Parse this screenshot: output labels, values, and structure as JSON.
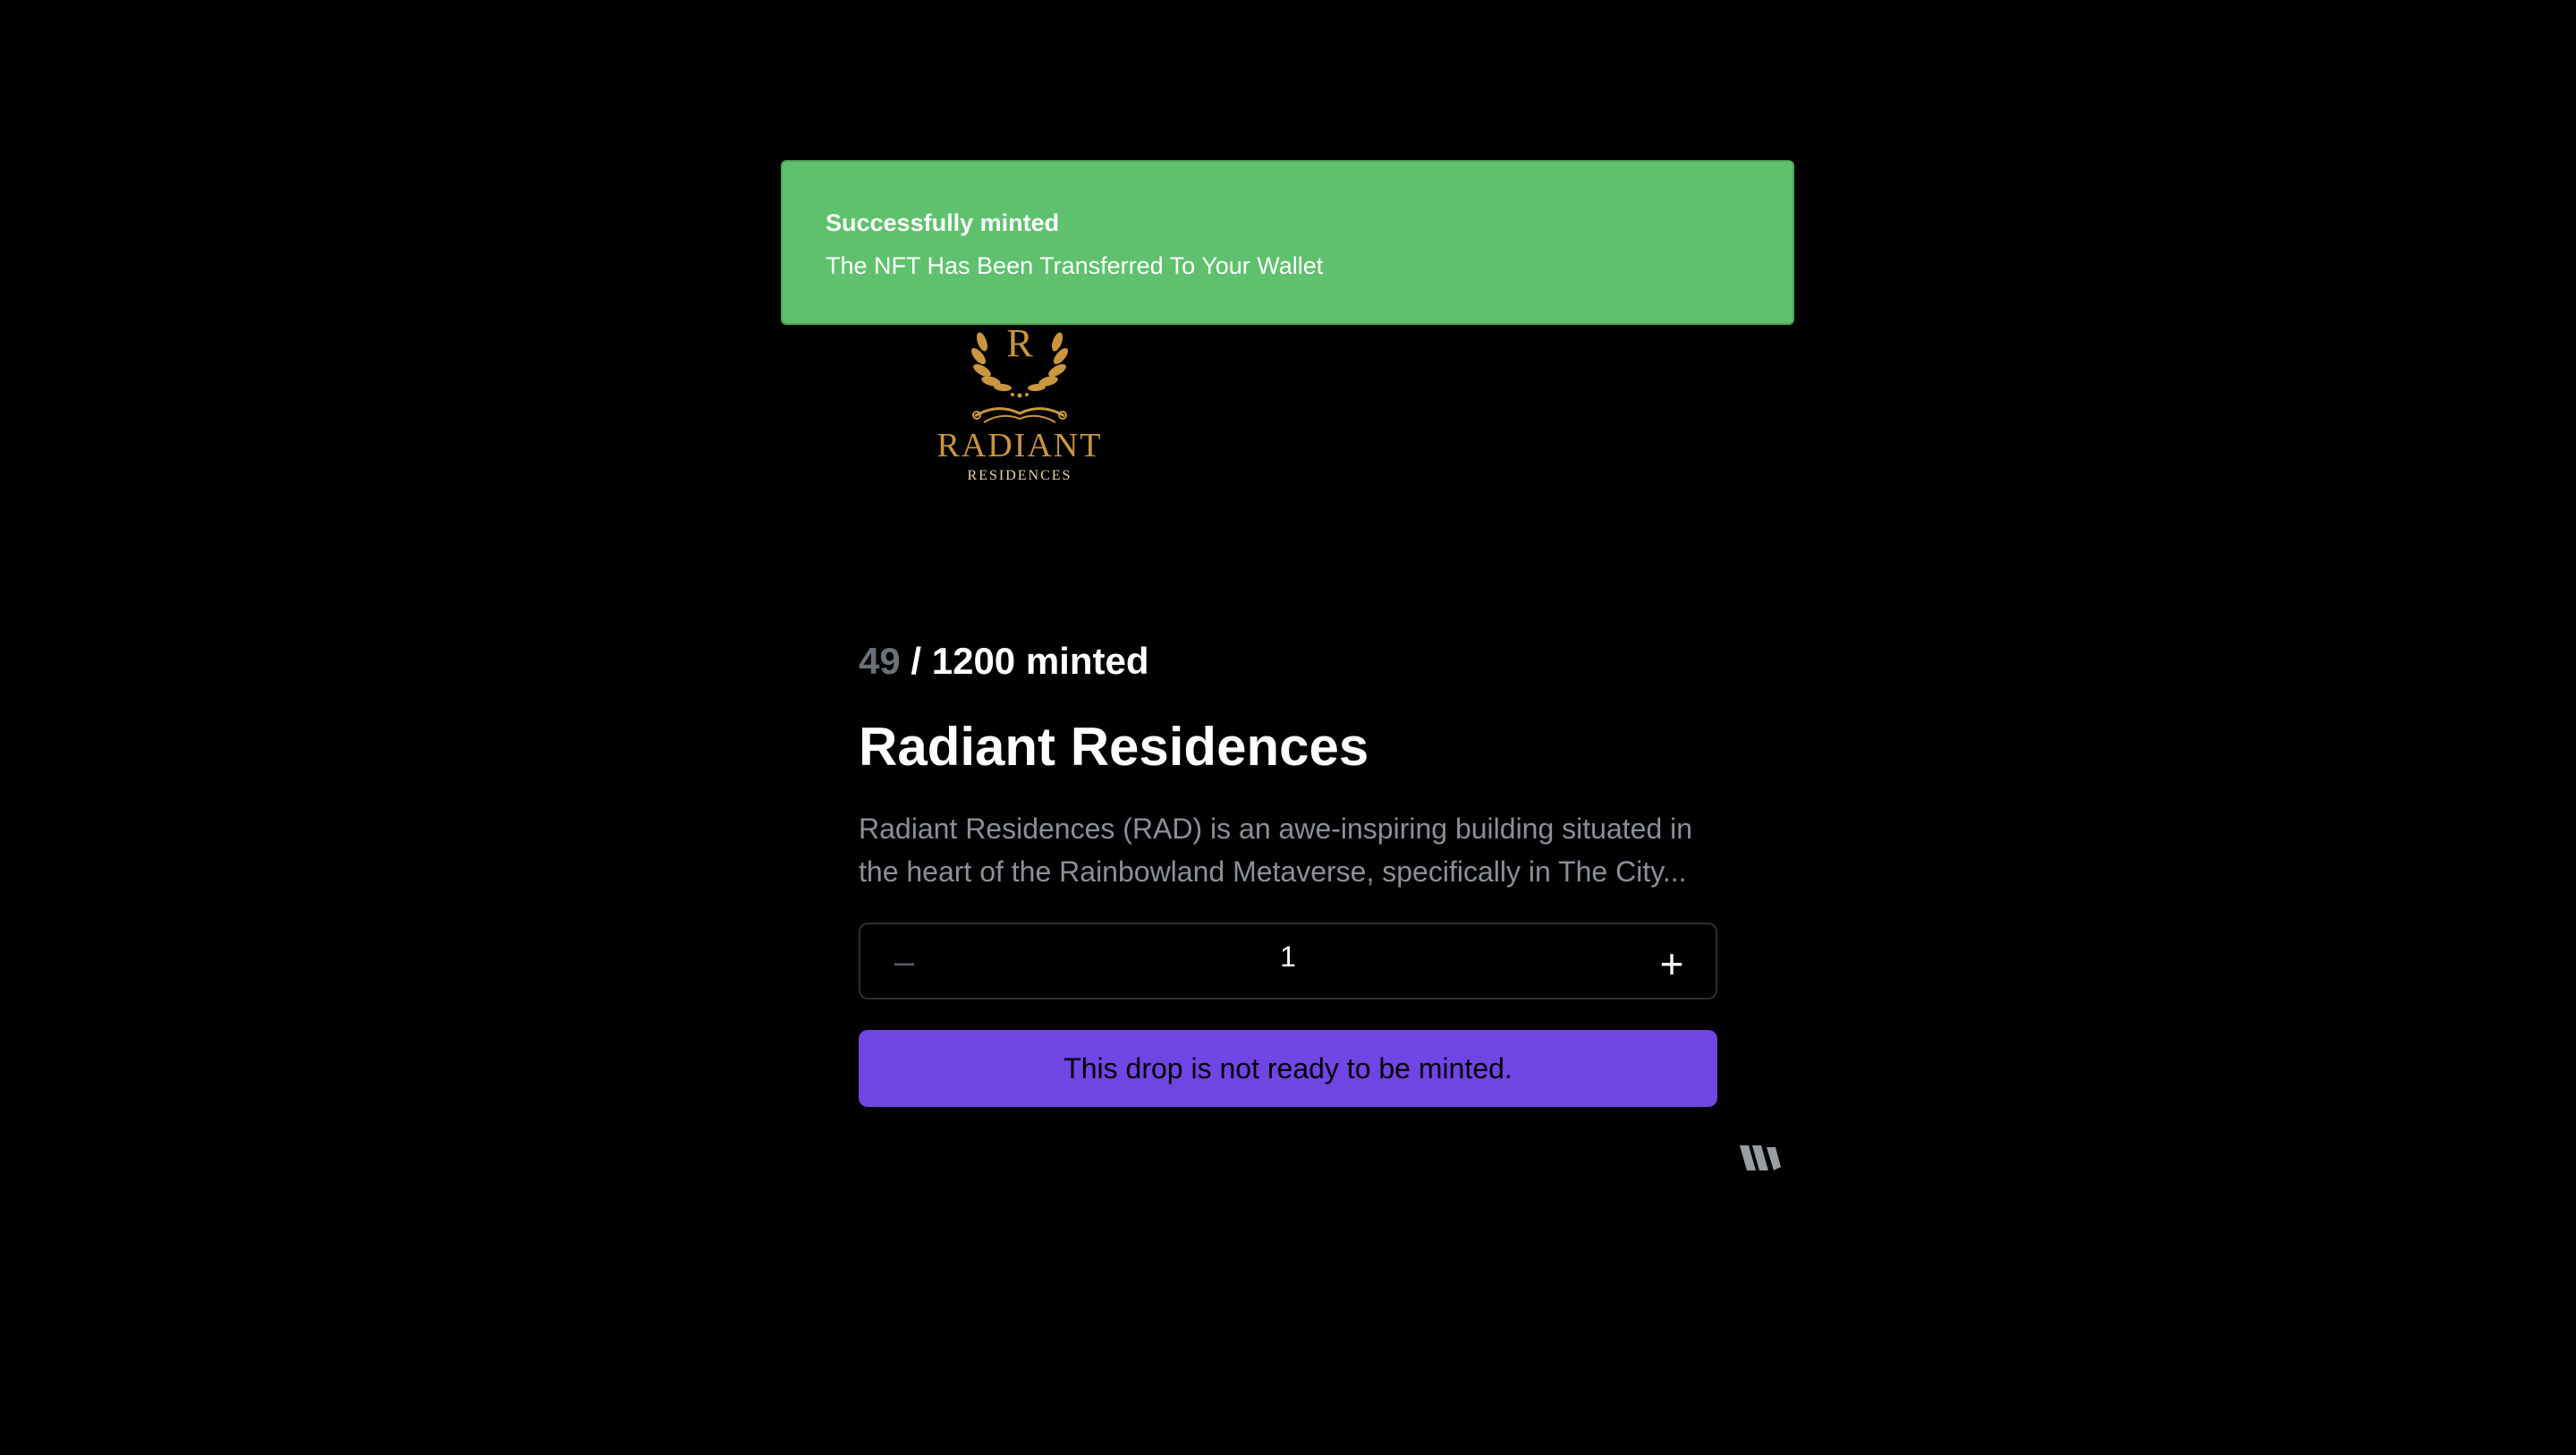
{
  "logo": {
    "monogram": "R",
    "name": "RADIANT",
    "subtitle": "RESIDENCES",
    "color": "#c9963f"
  },
  "toast": {
    "title": "Successfully minted",
    "message": "The NFT Has Been Transferred To Your Wallet",
    "color": "#5fc16d"
  },
  "drop": {
    "minted": "49",
    "total_label": "/ 1200 minted",
    "title": "Radiant Residences",
    "description": "Radiant Residences (RAD) is an awe-inspiring building situated in the heart of the Rainbowland Metaverse, specifically in The City..."
  },
  "stepper": {
    "minus_label": "–",
    "value": "1",
    "plus_label": "+"
  },
  "mint_button": {
    "label": "This drop is not ready to be minted.",
    "color": "#7144e4"
  },
  "footer": {
    "brand_icon": "thirdweb-logo-icon"
  }
}
